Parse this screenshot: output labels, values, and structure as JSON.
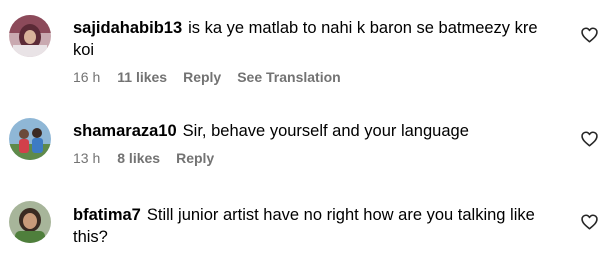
{
  "comments": [
    {
      "username": "sajidahabib13",
      "text": "is ka ye matlab to nahi k baron se batmeezy kre koi",
      "time": "16 h",
      "likes": "11 likes",
      "reply_label": "Reply",
      "translation_label": "See Translation",
      "avatar_icon": "avatar-woman-veiled"
    },
    {
      "username": "shamaraza10",
      "text": "Sir, behave yourself and your language",
      "time": "13 h",
      "likes": "8 likes",
      "reply_label": "Reply",
      "avatar_icon": "avatar-two-people-outdoors"
    },
    {
      "username": "bfatima7",
      "text": "Still junior artist have no right how are you talking like this?",
      "avatar_icon": "avatar-woman-green"
    }
  ],
  "like_icon": "heart-outline-icon",
  "colors": {
    "text": "#000000",
    "secondary": "#737373",
    "background": "#ffffff"
  }
}
